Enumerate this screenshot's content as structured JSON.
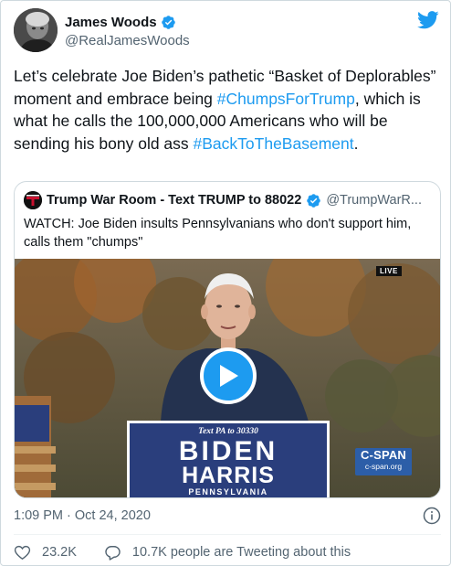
{
  "author": {
    "name": "James Woods",
    "handle": "@RealJamesWoods",
    "verified": true
  },
  "tweet": {
    "segments": [
      {
        "text": "Let’s celebrate Joe Biden’s pathetic “Basket of Deplorables” moment and embrace being ",
        "hashtag": false
      },
      {
        "text": "#ChumpsForTrump",
        "hashtag": true
      },
      {
        "text": ", which is what he calls the 100,000,000 Americans who will be sending his bony old ass ",
        "hashtag": false
      },
      {
        "text": "#BackToTheBasement",
        "hashtag": true
      },
      {
        "text": ".",
        "hashtag": false
      }
    ]
  },
  "quoted": {
    "name": "Trump War Room - Text TRUMP to 88022",
    "handle": "@TrumpWarR...",
    "verified": true,
    "text": "WATCH: Joe Biden insults Pennsylvanians who don't support him, calls them \"chumps\""
  },
  "video": {
    "live_label": "LIVE",
    "network_logo": "C-SPAN",
    "network_url": "c-span.org",
    "sign_top": "Text PA to 30330",
    "sign_line1": "BIDEN",
    "sign_line2": "HARRIS",
    "sign_line3": "PENNSYLVANIA"
  },
  "meta": {
    "timestamp": "1:09 PM · Oct 24, 2020"
  },
  "actions": {
    "likes": "23.2K",
    "replies_text": "10.7K people are Tweeting about this"
  },
  "colors": {
    "accent": "#1d9bf0",
    "text": "#0f1419",
    "muted": "#536471",
    "border": "#cfd9de"
  },
  "icons": {
    "brand": "twitter-bird-icon",
    "verified": "verified-badge-icon",
    "play": "play-icon",
    "info": "info-icon",
    "like": "heart-icon",
    "reply": "speech-bubble-icon"
  }
}
